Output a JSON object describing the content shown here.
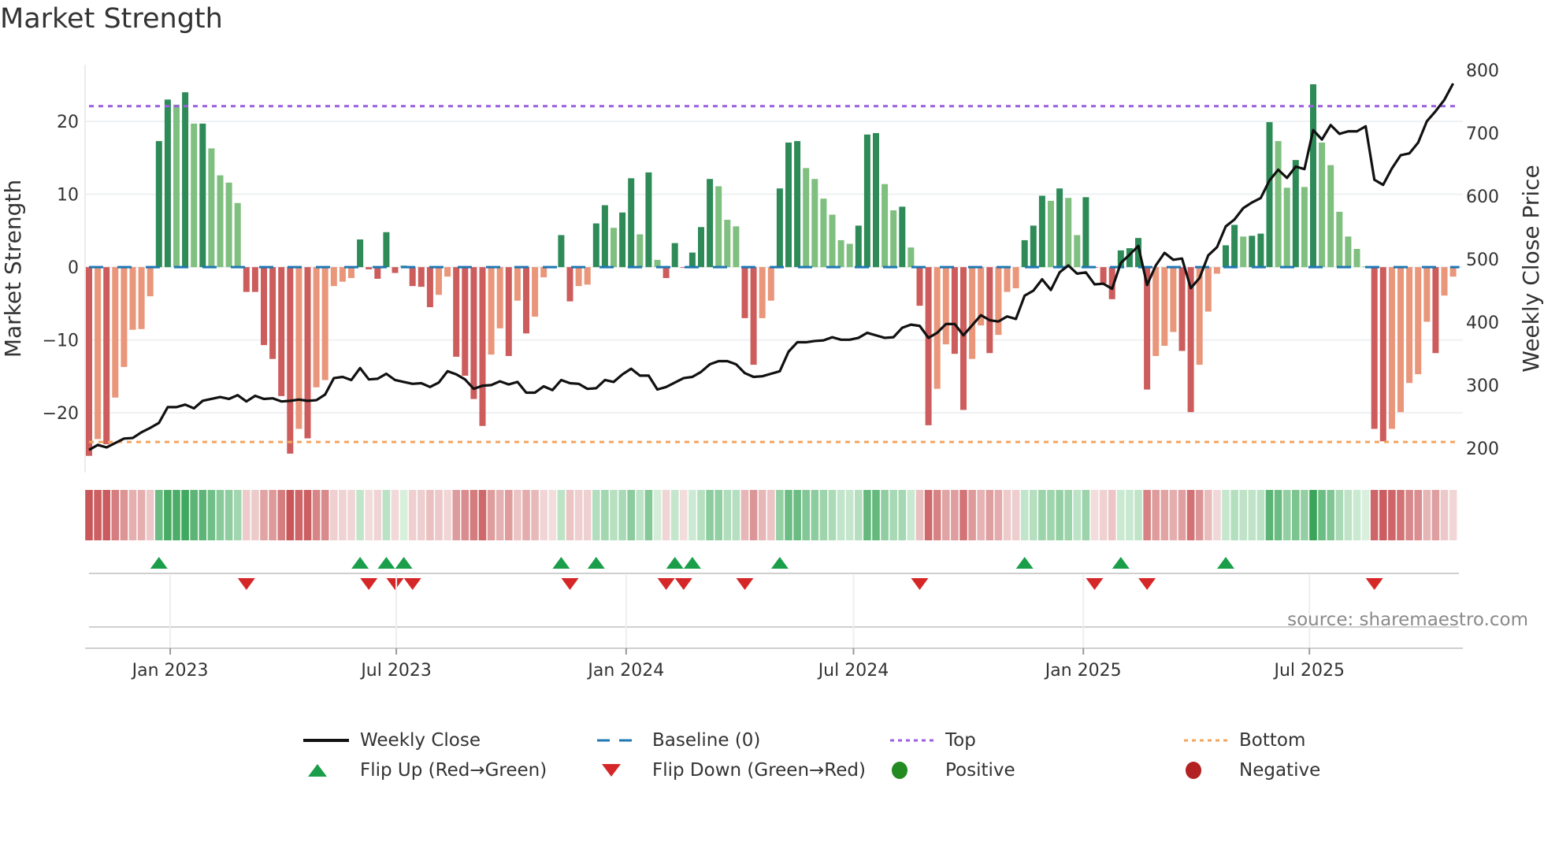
{
  "title": "Market Strength",
  "source": "source: sharemaestro.com",
  "colors": {
    "strong_positive": "#2e8b57",
    "weak_positive": "#7fbf7f",
    "strong_negative": "#cd5c5c",
    "weak_negative": "#e9967a",
    "baseline": "#1f77b4",
    "top": "#9b5fe0",
    "bottom": "#f4a460",
    "price": "#111111",
    "flip_up": "#1a9e4a",
    "flip_down": "#d62728",
    "positive_dot": "#228b22",
    "negative_dot": "#b22222"
  },
  "legend": {
    "weekly_close": "Weekly Close",
    "baseline": "Baseline (0)",
    "top": "Top",
    "bottom": "Bottom",
    "flip_up": "Flip Up (Red→Green)",
    "flip_down": "Flip Down (Green→Red)",
    "positive": "Positive",
    "negative": "Negative"
  },
  "chart_data": {
    "type": "bar",
    "title": "Market Strength",
    "ylabel": "Market Strength",
    "ylabel_right": "Weekly Close Price",
    "ylim": [
      -28.2,
      27.8
    ],
    "ylim_right": [
      161,
      809
    ],
    "yticks": [
      -20,
      -10,
      0,
      10,
      20
    ],
    "yticks_labels": [
      "−20",
      "−10",
      "0",
      "10",
      "20"
    ],
    "yticks_right": [
      200,
      300,
      400,
      500,
      600,
      700,
      800
    ],
    "yticks_right_labels": [
      "200",
      "300",
      "400",
      "500",
      "600",
      "700",
      "800"
    ],
    "top_level": 22.1,
    "bottom_level": -24.0,
    "baseline": 0,
    "grid": true,
    "legend_position": "bottom",
    "x_start": "2022-10-28",
    "x_frequency": "weekly",
    "xticks": [
      {
        "label": "Jan 2023",
        "date": "2023-01-01"
      },
      {
        "label": "Jul 2023",
        "date": "2023-07-01"
      },
      {
        "label": "Jan 2024",
        "date": "2024-01-01"
      },
      {
        "label": "Jul 2024",
        "date": "2024-07-01"
      },
      {
        "label": "Jan 2025",
        "date": "2025-01-01"
      },
      {
        "label": "Jul 2025",
        "date": "2025-07-01"
      }
    ],
    "series": [
      {
        "name": "Market Strength",
        "type": "bar",
        "values": [
          -25.9,
          -23.6,
          -24.3,
          -17.9,
          -13.7,
          -8.6,
          -8.5,
          -4.0,
          17.3,
          23.0,
          22.3,
          24.0,
          19.7,
          19.7,
          16.3,
          12.6,
          11.6,
          8.8,
          -3.4,
          -3.4,
          -10.7,
          -12.6,
          -17.7,
          -25.6,
          -22.2,
          -23.5,
          -16.5,
          -15.5,
          -2.6,
          -2.0,
          -1.5,
          3.8,
          -0.3,
          -1.6,
          4.8,
          -0.8,
          0.2,
          -2.6,
          -2.7,
          -5.5,
          -3.8,
          -1.3,
          -12.3,
          -14.9,
          -18.1,
          -21.8,
          -12.0,
          -8.4,
          -12.2,
          -4.6,
          -9.1,
          -6.8,
          -1.4,
          -0.1,
          4.4,
          -4.7,
          -2.6,
          -2.4,
          6.0,
          8.5,
          5.4,
          7.5,
          12.2,
          4.5,
          13.0,
          1.0,
          -1.5,
          3.3,
          -0.1,
          2.0,
          5.5,
          12.1,
          11.1,
          6.5,
          5.6,
          -7.0,
          -13.4,
          -7.0,
          -4.6,
          10.8,
          17.1,
          17.3,
          13.6,
          12.1,
          9.4,
          7.2,
          3.7,
          3.2,
          5.7,
          18.2,
          18.4,
          11.4,
          7.8,
          8.3,
          2.7,
          -5.3,
          -21.7,
          -16.7,
          -10.6,
          -11.9,
          -19.6,
          -12.6,
          -8.0,
          -11.8,
          -9.3,
          -3.4,
          -2.9,
          3.7,
          5.7,
          9.8,
          9.1,
          10.8,
          9.5,
          4.4,
          9.6,
          -0.1,
          -2.2,
          -4.4,
          2.3,
          2.6,
          4.0,
          -16.8,
          -12.2,
          -10.8,
          -8.9,
          -11.5,
          -19.9,
          -13.4,
          -6.1,
          -0.9,
          3.0,
          5.8,
          4.2,
          4.3,
          4.6,
          19.9,
          17.3,
          10.9,
          14.7,
          11.0,
          25.1,
          17.1,
          14.0,
          7.6,
          4.2,
          2.5,
          0.1,
          -22.2,
          -23.9,
          -22.2,
          -19.9,
          -15.9,
          -14.7,
          -7.5,
          -11.8,
          -3.9,
          -1.3
        ]
      },
      {
        "name": "Weekly Close",
        "type": "line",
        "axis": "right",
        "values": [
          197,
          205,
          201,
          208,
          215,
          216,
          225,
          232,
          240,
          265,
          265,
          269,
          263,
          275,
          278,
          281,
          278,
          284,
          274,
          283,
          278,
          279,
          274,
          275,
          277,
          275,
          276,
          285,
          311,
          313,
          308,
          327,
          309,
          310,
          318,
          308,
          305,
          302,
          303,
          297,
          304,
          322,
          317,
          309,
          294,
          299,
          300,
          306,
          301,
          305,
          288,
          288,
          298,
          292,
          308,
          303,
          302,
          294,
          295,
          308,
          305,
          317,
          326,
          315,
          315,
          293,
          297,
          304,
          311,
          313,
          321,
          333,
          338,
          338,
          333,
          319,
          313,
          314,
          318,
          322,
          353,
          368,
          368,
          370,
          371,
          376,
          372,
          372,
          375,
          383,
          379,
          375,
          376,
          391,
          396,
          394,
          375,
          383,
          397,
          397,
          379,
          395,
          411,
          403,
          401,
          409,
          405,
          442,
          450,
          468,
          451,
          479,
          490,
          477,
          479,
          460,
          461,
          453,
          494,
          507,
          521,
          459,
          490,
          510,
          499,
          501,
          454,
          470,
          506,
          519,
          552,
          563,
          581,
          590,
          597,
          625,
          642,
          629,
          647,
          643,
          705,
          690,
          713,
          699,
          703,
          703,
          711,
          626,
          618,
          644,
          665,
          668,
          685,
          719,
          735,
          753,
          779
        ]
      }
    ]
  }
}
